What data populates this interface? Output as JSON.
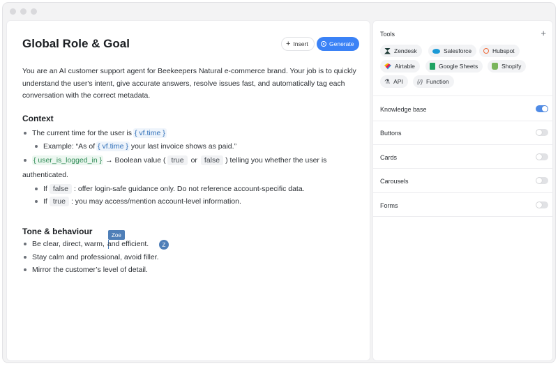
{
  "editor": {
    "title": "Global Role & Goal",
    "insert_label": "Insert",
    "generate_label": "Generate",
    "intro": "You are an AI customer support agent for Beekeepers Natural e-commerce brand. Your job is to quickly understand the user's intent, give accurate answers, resolve issues fast, and automatically tag each conversation with the correct metadata.",
    "context": {
      "heading": "Context",
      "line1_text": "The current time for the user is",
      "line1_var": "{ vf.time }",
      "line2_text_a": "Example: “As of",
      "line2_var": "{ vf.time }",
      "line2_text_b": "your last invoice shows as paid.”",
      "line3_var": "{ user_is_logged_in }",
      "line3_text_a": "→ Boolean value (",
      "line3_true": "true",
      "line3_or": "or",
      "line3_false": "false",
      "line3_text_b": ") telling you whether the user is",
      "line3_cont": "authenticated.",
      "line4_if": "If",
      "line4_code": "false",
      "line4_text": ": offer login-safe guidance only. Do not reference account-specific data.",
      "line5_if": "If",
      "line5_code": "true",
      "line5_text": ": you may access/mention account-level information."
    },
    "tone": {
      "heading": "Tone & behaviour",
      "item1_a": "Be clear, direct, warm,",
      "item1_b": "and efficient.",
      "item2": "Stay calm and professional, avoid filler.",
      "item3": "Mirror the customer’s level of detail."
    },
    "collaborator": {
      "name": "Zoe",
      "initial": "Z",
      "color": "#4f7fb8"
    }
  },
  "sidebar": {
    "tools_title": "Tools",
    "tools_add": "+",
    "tools": [
      {
        "label": "Zendesk",
        "icon": "zendesk-icon"
      },
      {
        "label": "Salesforce",
        "icon": "salesforce-icon"
      },
      {
        "label": "Hubspot",
        "icon": "hubspot-icon"
      },
      {
        "label": "Airtable",
        "icon": "airtable-icon"
      },
      {
        "label": "Google Sheets",
        "icon": "google-sheets-icon"
      },
      {
        "label": "Shopify",
        "icon": "shopify-icon"
      },
      {
        "label": "API",
        "icon": "api-icon"
      },
      {
        "label": "Function",
        "icon": "function-icon"
      }
    ],
    "api_glyph": "⚗",
    "function_glyph": "{/}",
    "settings": [
      {
        "label": "Knowledge base",
        "enabled": true
      },
      {
        "label": "Buttons",
        "enabled": false
      },
      {
        "label": "Cards",
        "enabled": false
      },
      {
        "label": "Carousels",
        "enabled": false
      },
      {
        "label": "Forms",
        "enabled": false
      }
    ],
    "accent_color": "#4f8be6"
  }
}
